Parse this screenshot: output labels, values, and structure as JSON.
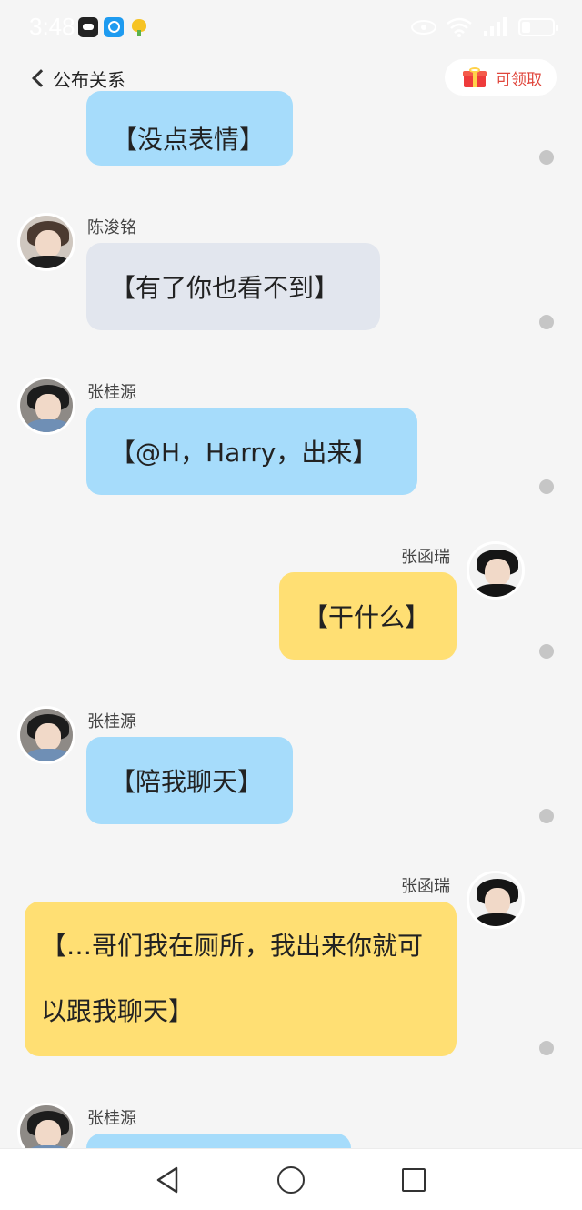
{
  "status_bar": {
    "time": "3:48",
    "icons": [
      "bear-app-icon",
      "search-app-icon",
      "flower-app-icon",
      "eye-icon",
      "wifi-icon",
      "signal-icon",
      "battery-icon"
    ]
  },
  "header": {
    "back_label": "公布关系",
    "reward_label": "可领取"
  },
  "messages": [
    {
      "sender": "",
      "text": "【没点表情】",
      "side": "left",
      "color": "blue"
    },
    {
      "sender": "陈浚铭",
      "text": "【有了你也看不到】",
      "side": "left",
      "color": "grey"
    },
    {
      "sender": "张桂源",
      "text": "【@H，Harry，出来】",
      "side": "left",
      "color": "blue"
    },
    {
      "sender": "张函瑞",
      "text": "【干什么】",
      "side": "right",
      "color": "yellow"
    },
    {
      "sender": "张桂源",
      "text": "【陪我聊天】",
      "side": "left",
      "color": "blue"
    },
    {
      "sender": "张函瑞",
      "text": "【…哥们我在厕所，我出来你就可以跟我聊天】",
      "side": "right",
      "color": "yellow"
    },
    {
      "sender": "张桂源",
      "text": "",
      "side": "left",
      "color": "blue"
    }
  ],
  "colors": {
    "bubble_blue": "#a6dcfb",
    "bubble_grey": "#e2e6ee",
    "bubble_yellow": "#ffdf73",
    "reward_text": "#e0463c",
    "background": "#f5f5f5"
  },
  "nav": [
    "nav-back-icon",
    "nav-home-icon",
    "nav-recent-icon"
  ]
}
